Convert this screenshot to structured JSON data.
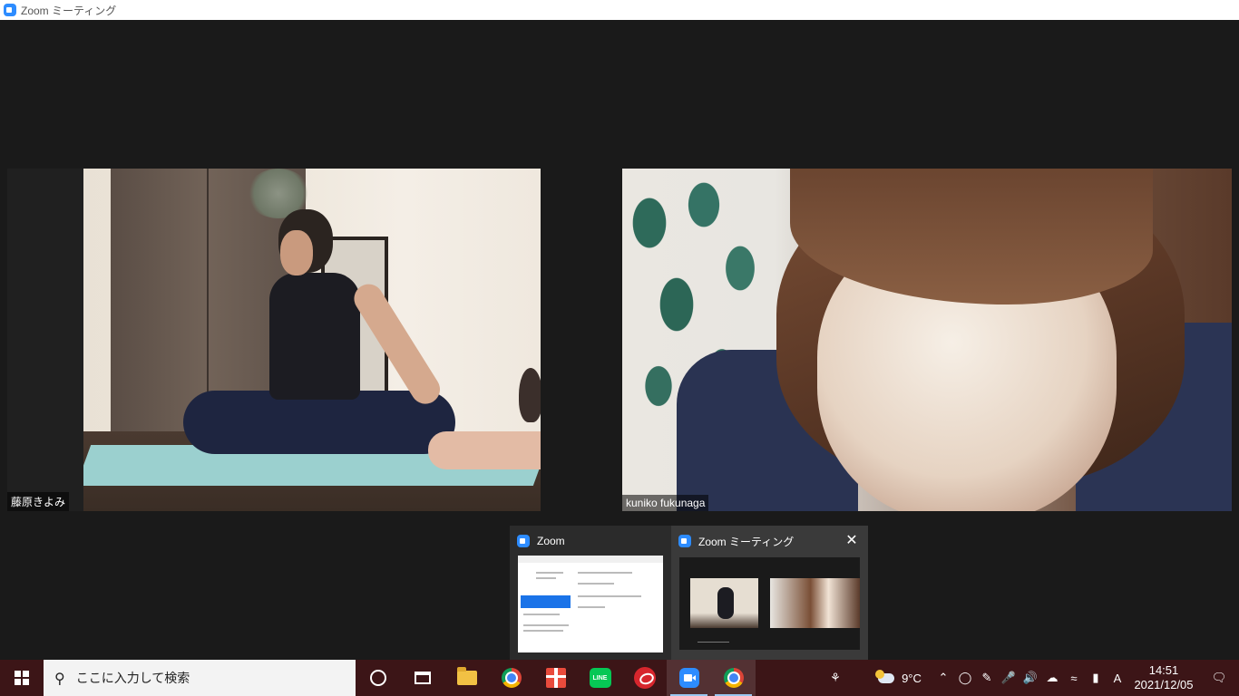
{
  "window": {
    "title": "Zoom ミーティング",
    "icon": "zoom-icon",
    "accent": "#2d8cff"
  },
  "participants": [
    {
      "name": "藤原きよみ"
    },
    {
      "name": "kuniko fukunaga"
    }
  ],
  "taskbar_preview": {
    "items": [
      {
        "label": "Zoom",
        "icon": "zoom-icon"
      },
      {
        "label": "Zoom ミーティング",
        "icon": "zoom-icon",
        "close": "✕"
      }
    ]
  },
  "taskbar": {
    "background": "#3c1517",
    "search_placeholder": "ここに入力して検索",
    "line_label": "LINE",
    "apps": [
      "cortana-icon",
      "task-view-icon",
      "file-explorer-icon",
      "chrome-icon",
      "gift-icon",
      "line-icon",
      "trend-micro-icon",
      "zoom-icon",
      "chrome-icon"
    ]
  },
  "tray": {
    "temperature": "9°C",
    "ime_mode": "A",
    "time": "14:51",
    "date": "2021/12/05"
  }
}
